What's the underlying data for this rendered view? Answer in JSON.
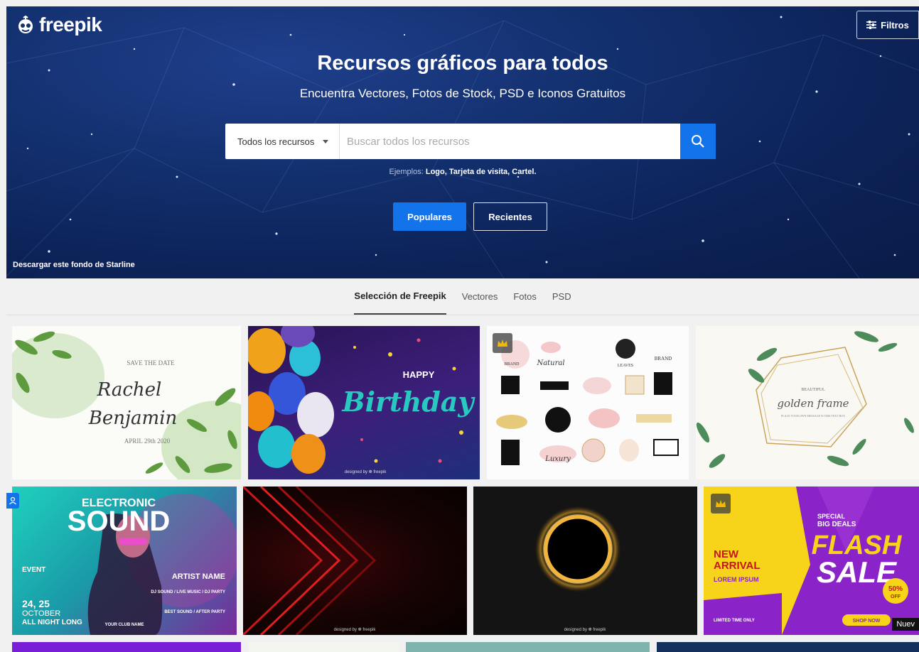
{
  "header": {
    "logo_text": "freepik",
    "filters_label": "Filtros",
    "title": "Recursos gráficos para todos",
    "subtitle": "Encuentra Vectores, Fotos de Stock, PSD e Iconos Gratuitos",
    "credit": "Descargar este fondo de Starline"
  },
  "search": {
    "type_label": "Todos los recursos",
    "placeholder": "Buscar todos los recursos",
    "examples_label": "Ejemplos:",
    "examples": "Logo, Tarjeta de visita, Cartel."
  },
  "sort_buttons": {
    "popular": "Populares",
    "recent": "Recientes"
  },
  "category_tabs": [
    "Selección de Freepik",
    "Vectores",
    "Fotos",
    "PSD"
  ],
  "tiles": {
    "wedding": {
      "save_date": "SAVE THE DATE",
      "name1": "Rachel",
      "name2": "Benjamin",
      "date": "APRIL 29th 2020"
    },
    "birthday": {
      "happy": "HAPPY",
      "birthday": "Birthday",
      "credit": "designed by ❁ freepik"
    },
    "logos": {
      "brand": "BRAND",
      "natural": "Natural",
      "leaves": "LEAVES",
      "luxury": "Luxury"
    },
    "golden": {
      "beautiful": "BEAUTIFUL",
      "golden": "golden frame",
      "place": "PLACE YOUR OWN MESSAGE IS THIS TEXT BOX"
    },
    "sound": {
      "electronic": "ELECTRONIC",
      "sound": "SOUND",
      "event": "EVENT",
      "artist": "ARTIST NAME",
      "dates": "24, 25",
      "month": "OCTOBER",
      "night": "ALL NIGHT LONG",
      "club": "YOUR CLUB NAME",
      "dj": "DJ SOUND / LIVE MUSIC / DJ PARTY",
      "best": "BEST SOUND / AFTER PARTY"
    },
    "red": {
      "credit": "designed by ❁ freepik"
    },
    "gold_ring": {
      "credit": "designed by ❁ freepik"
    },
    "flash": {
      "new": "NEW",
      "arrival": "ARRIVAL",
      "lorem": "LOREM IPSUM",
      "special": "SPECIAL",
      "big_deals": "BIG DEALS",
      "flash": "FLASH",
      "sale": "SALE",
      "off_pct": "50%",
      "off": "OFF",
      "limited": "LIMITED TIME ONLY",
      "shop": "SHOP NOW",
      "new_badge": "Nuev"
    }
  }
}
